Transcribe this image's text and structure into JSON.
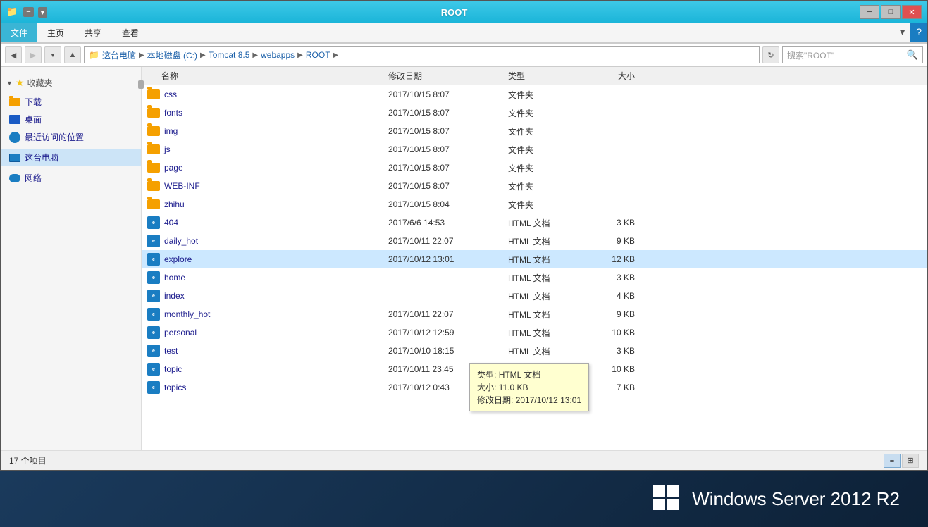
{
  "window": {
    "title": "ROOT",
    "title_icons": [
      "📁",
      "−",
      "□",
      "✕"
    ]
  },
  "ribbon": {
    "tabs": [
      "文件",
      "主页",
      "共享",
      "查看"
    ]
  },
  "address": {
    "path_items": [
      "这台电脑",
      "本地磁盘 (C:)",
      "Tomcat 8.5",
      "webapps",
      "ROOT"
    ],
    "search_placeholder": "搜索\"ROOT\""
  },
  "sidebar": {
    "favorites_label": "收藏夹",
    "items_favorites": [
      {
        "label": "下载",
        "icon": "folder"
      },
      {
        "label": "桌面",
        "icon": "desktop"
      },
      {
        "label": "最近访问的位置",
        "icon": "recent"
      }
    ],
    "items_computer": [
      {
        "label": "这台电脑",
        "icon": "computer",
        "selected": true
      }
    ],
    "items_network": [
      {
        "label": "网络",
        "icon": "network"
      }
    ]
  },
  "columns": {
    "name": "名称",
    "date": "修改日期",
    "type": "类型",
    "size": "大小"
  },
  "files": [
    {
      "name": "css",
      "date": "2017/10/15 8:07",
      "type": "文件夹",
      "size": "",
      "is_folder": true
    },
    {
      "name": "fonts",
      "date": "2017/10/15 8:07",
      "type": "文件夹",
      "size": "",
      "is_folder": true
    },
    {
      "name": "img",
      "date": "2017/10/15 8:07",
      "type": "文件夹",
      "size": "",
      "is_folder": true
    },
    {
      "name": "js",
      "date": "2017/10/15 8:07",
      "type": "文件夹",
      "size": "",
      "is_folder": true
    },
    {
      "name": "page",
      "date": "2017/10/15 8:07",
      "type": "文件夹",
      "size": "",
      "is_folder": true
    },
    {
      "name": "WEB-INF",
      "date": "2017/10/15 8:07",
      "type": "文件夹",
      "size": "",
      "is_folder": true
    },
    {
      "name": "zhihu",
      "date": "2017/10/15 8:04",
      "type": "文件夹",
      "size": "",
      "is_folder": true
    },
    {
      "name": "404",
      "date": "2017/6/6 14:53",
      "type": "HTML 文档",
      "size": "3 KB",
      "is_folder": false
    },
    {
      "name": "daily_hot",
      "date": "2017/10/11 22:07",
      "type": "HTML 文档",
      "size": "9 KB",
      "is_folder": false
    },
    {
      "name": "explore",
      "date": "2017/10/12 13:01",
      "type": "HTML 文档",
      "size": "12 KB",
      "is_folder": false,
      "selected": true
    },
    {
      "name": "home",
      "date": "",
      "type": "HTML 文档",
      "size": "3 KB",
      "is_folder": false
    },
    {
      "name": "index",
      "date": "",
      "type": "HTML 文档",
      "size": "4 KB",
      "is_folder": false
    },
    {
      "name": "monthly_hot",
      "date": "2017/10/11 22:07",
      "type": "HTML 文档",
      "size": "9 KB",
      "is_folder": false
    },
    {
      "name": "personal",
      "date": "2017/10/12 12:59",
      "type": "HTML 文档",
      "size": "10 KB",
      "is_folder": false
    },
    {
      "name": "test",
      "date": "2017/10/10 18:15",
      "type": "HTML 文档",
      "size": "3 KB",
      "is_folder": false
    },
    {
      "name": "topic",
      "date": "2017/10/11 23:45",
      "type": "HTML 文档",
      "size": "10 KB",
      "is_folder": false
    },
    {
      "name": "topics",
      "date": "2017/10/12 0:43",
      "type": "HTML 文档",
      "size": "7 KB",
      "is_folder": false
    }
  ],
  "tooltip": {
    "type_label": "类型:",
    "type_value": "HTML 文档",
    "size_label": "大小:",
    "size_value": "11.0 KB",
    "date_label": "修改日期:",
    "date_value": "2017/10/12 13:01"
  },
  "status": {
    "item_count": "17 个项目"
  },
  "taskbar": {
    "os_name": "Windows Server 2012 R2"
  }
}
